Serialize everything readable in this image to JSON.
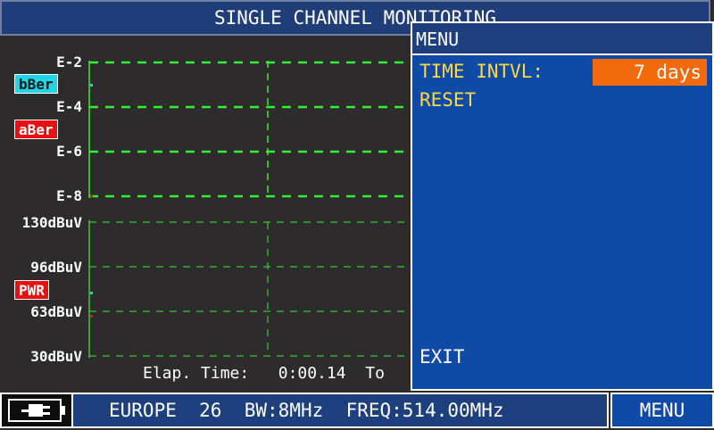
{
  "header": {
    "title": "SINGLE CHANNEL MONITORING"
  },
  "ber_axis": {
    "ticks": [
      "E-2",
      "E-4",
      "E-6",
      "E-8"
    ]
  },
  "power_axis": {
    "ticks": [
      "130dBuV",
      "96dBuV",
      "63dBuV",
      "30dBuV"
    ]
  },
  "legend": {
    "bber": {
      "label": "bBer",
      "color": "#1ed6e6"
    },
    "aber": {
      "label": "aBer",
      "color": "#e81010"
    },
    "pwr": {
      "label": "PWR",
      "color": "#e81010"
    }
  },
  "footer": {
    "elapsed_label": "Elap. Time:",
    "elapsed_value": "0:00.14",
    "total_partial": "To"
  },
  "menu": {
    "title": "MENU",
    "items": [
      {
        "label": "TIME INTVL:",
        "value": "7 days"
      },
      {
        "label": "RESET"
      }
    ],
    "exit_label": "EXIT"
  },
  "status": {
    "region": "EUROPE",
    "channel": "26",
    "bandwidth": "BW:8MHz",
    "frequency": "FREQ:514.00MHz"
  },
  "softkey": {
    "menu_label": "MENU"
  },
  "colors": {
    "grid_ber": "#33ee33",
    "grid_pwr": "#33cc33",
    "menu_bg": "#0e4aa6",
    "highlight": "#f26a0c"
  }
}
